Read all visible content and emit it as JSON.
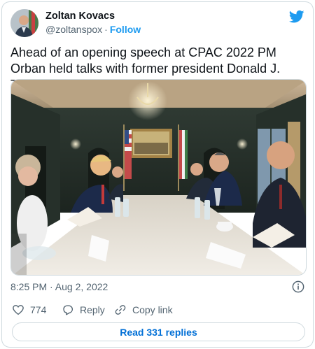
{
  "author": {
    "name": "Zoltan Kovacs",
    "handle": "@zoltanspox",
    "follow_label": "Follow",
    "separator": "·"
  },
  "tweet": {
    "text": "Ahead of an opening speech at CPAC 2022 PM Orban held talks with former president Donald J. Trump",
    "timestamp": "8:25 PM · Aug 2, 2022"
  },
  "actions": {
    "like_count": "774",
    "reply_label": "Reply",
    "copy_label": "Copy link"
  },
  "read_replies_label": "Read 331 replies",
  "colors": {
    "accent": "#1d9bf0",
    "link": "#006fd6",
    "text": "#0f1419",
    "muted": "#536471",
    "border": "#cfd9de"
  },
  "icons": [
    "twitter-logo",
    "info-icon",
    "heart-icon",
    "reply-icon",
    "link-icon"
  ]
}
